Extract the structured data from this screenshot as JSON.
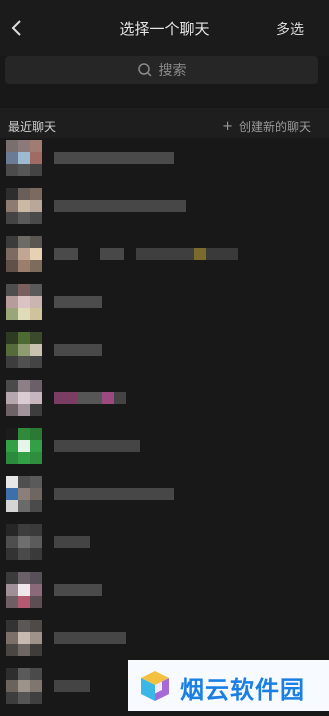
{
  "header": {
    "title": "选择一个聊天",
    "multi_select": "多选"
  },
  "search": {
    "placeholder": "搜索"
  },
  "section": {
    "title": "最近聊天",
    "create_label": "创建新的聊天"
  },
  "watermark": {
    "text": "烟云软件园"
  },
  "icons": {
    "back": "back-arrow-icon",
    "search": "search-icon",
    "plus": "plus-icon",
    "logo": "cube-logo"
  },
  "colors": {
    "background": "#181818",
    "watermark_text": "#1a7fe3"
  }
}
